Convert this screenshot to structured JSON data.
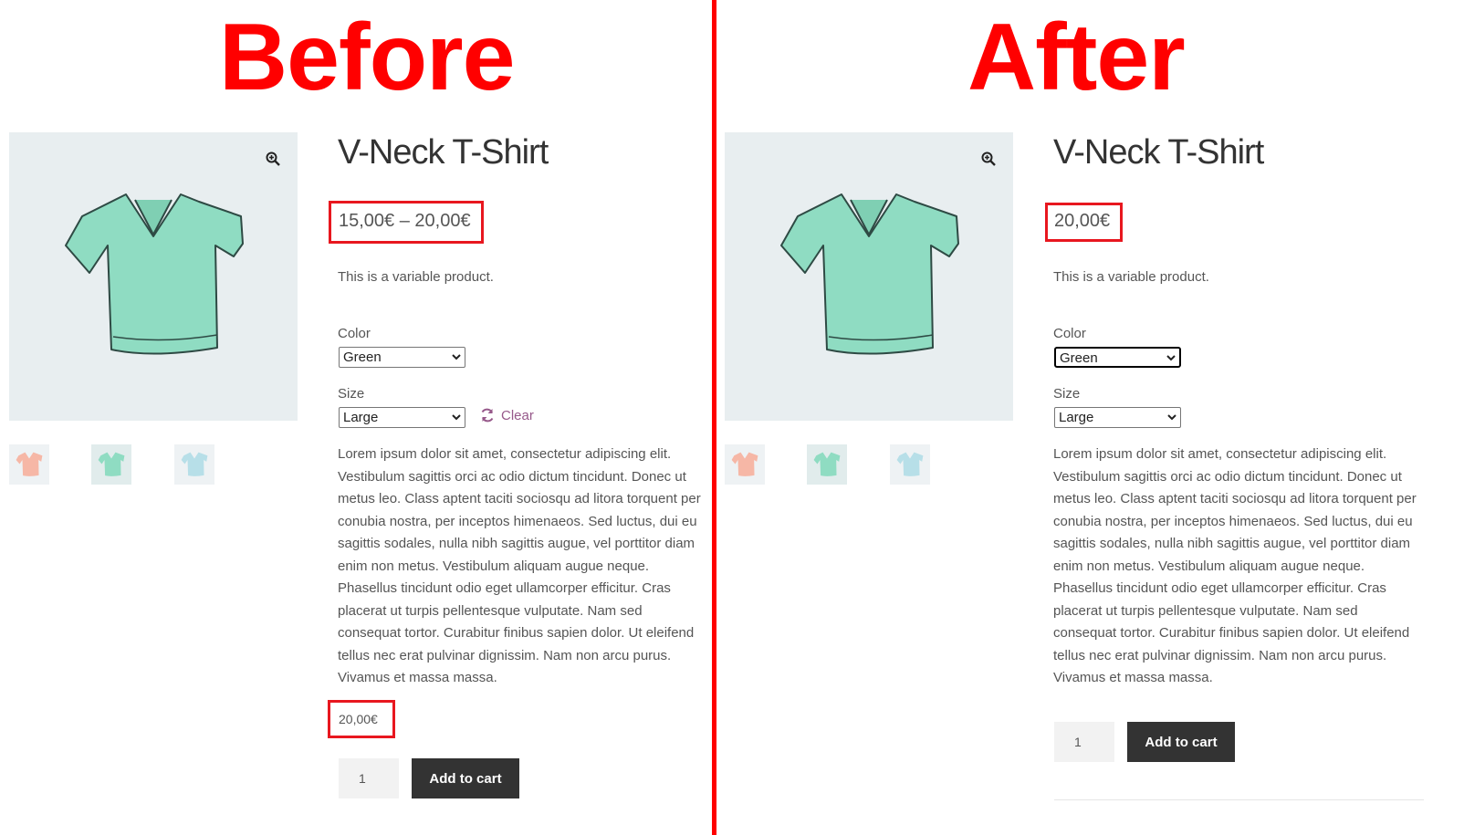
{
  "headings": {
    "before": "Before",
    "after": "After"
  },
  "product": {
    "title": "V-Neck T-Shirt",
    "short_description": "This is a variable product.",
    "color_label": "Color",
    "color_value": "Green",
    "size_label": "Size",
    "size_value": "Large",
    "clear_label": "Clear",
    "long_description": "Lorem ipsum dolor sit amet, consectetur adipiscing elit. Vestibulum sagittis orci ac odio dictum tincidunt. Donec ut metus leo. Class aptent taciti sociosqu ad litora torquent per conubia nostra, per inceptos himenaeos. Sed luctus, dui eu sagittis sodales, nulla nibh sagittis augue, vel porttitor diam enim non metus. Vestibulum aliquam augue neque. Phasellus tincidunt odio eget ullamcorper efficitur. Cras placerat ut turpis pellentesque vulputate. Nam sed consequat tortor. Curabitur finibus sapien dolor. Ut eleifend tellus nec erat pulvinar dignissim. Nam non arcu purus. Vivamus et massa massa.",
    "quantity": "1",
    "add_to_cart_label": "Add to cart"
  },
  "before": {
    "price": "15,00€ – 20,00€",
    "variation_price": "20,00€"
  },
  "after": {
    "price": "20,00€"
  },
  "colors": {
    "highlight": "#e8171f",
    "divider": "#ff0000",
    "shirt_green": "#8fdcc2",
    "shirt_pink": "#f6b7a6",
    "shirt_blue": "#b7dfe8",
    "clear_link": "#96588a",
    "button": "#333333"
  },
  "icons": [
    "zoom-in-icon",
    "refresh-icon",
    "chevron-down-icon"
  ]
}
